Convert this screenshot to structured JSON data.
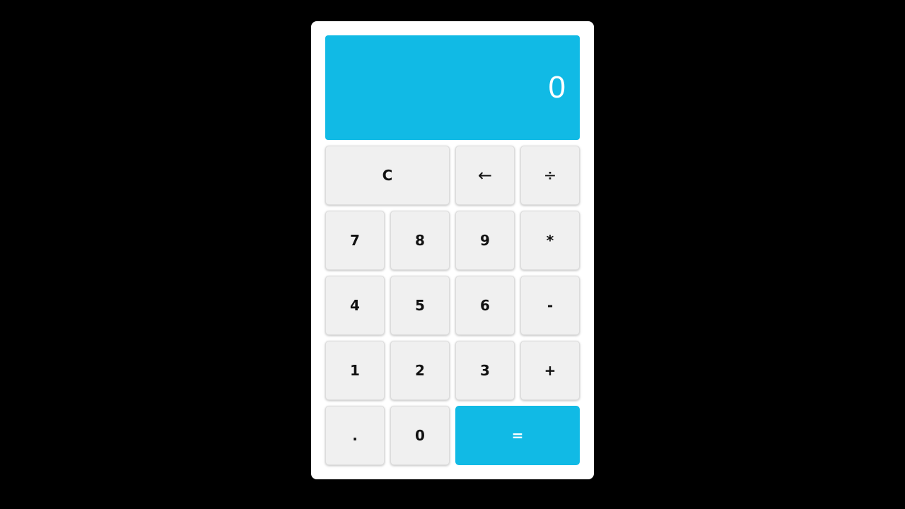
{
  "theme": {
    "accent": "#11bae5",
    "key_bg": "#f0f0f0",
    "background": "#000000"
  },
  "display": {
    "value": "0"
  },
  "keys": {
    "clear": "C",
    "backspace": "←",
    "divide": "÷",
    "seven": "7",
    "eight": "8",
    "nine": "9",
    "multiply": "*",
    "four": "4",
    "five": "5",
    "six": "6",
    "subtract": "-",
    "one": "1",
    "two": "2",
    "three": "3",
    "add": "+",
    "decimal": ".",
    "zero": "0",
    "equals": "="
  }
}
